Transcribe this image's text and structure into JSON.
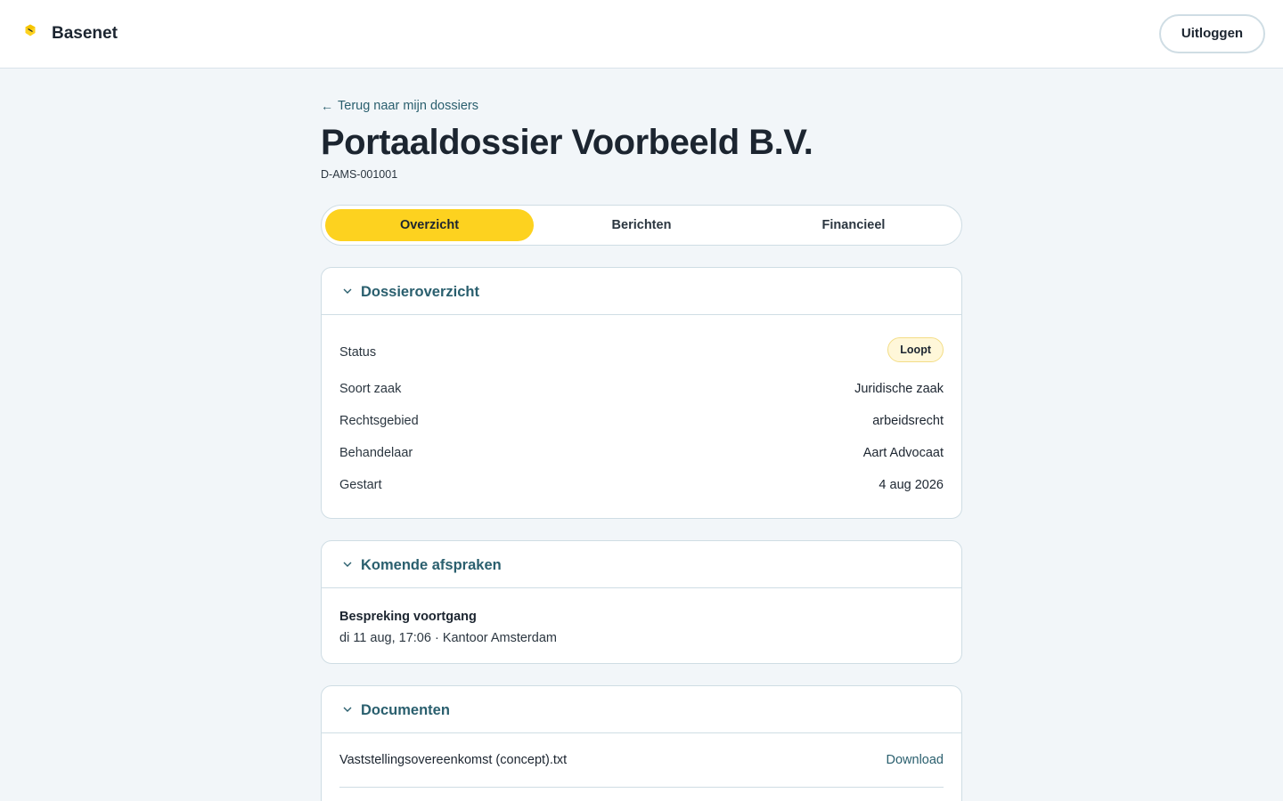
{
  "app": {
    "brand": "Basenet",
    "logout_label": "Uitloggen"
  },
  "page": {
    "back_link": "Terug naar mijn dossiers",
    "title": "Portaaldossier Voorbeeld B.V.",
    "code": "D-AMS-001001"
  },
  "tabs": [
    {
      "label": "Overzicht",
      "active": true
    },
    {
      "label": "Berichten",
      "active": false
    },
    {
      "label": "Financieel",
      "active": false
    }
  ],
  "overview": {
    "title": "Dossieroverzicht",
    "status_label": "Status",
    "status_value": "Loopt",
    "rows": [
      {
        "label": "Soort zaak",
        "value": "Juridische zaak"
      },
      {
        "label": "Rechtsgebied",
        "value": "arbeidsrecht"
      },
      {
        "label": "Behandelaar",
        "value": "Aart Advocaat"
      },
      {
        "label": "Gestart",
        "value": "4 aug 2026"
      }
    ]
  },
  "appointments": {
    "title": "Komende afspraken",
    "items": [
      {
        "title": "Bespreking voortgang",
        "detail": "di 11 aug, 17:06 · Kantoor Amsterdam"
      }
    ]
  },
  "documents": {
    "title": "Documenten",
    "items": [
      {
        "name": "Vaststellingsovereenkomst (concept).txt",
        "action": "Download"
      }
    ]
  },
  "colors": {
    "accent": "#fdd21f",
    "link": "#2a5f6e",
    "border": "#cfdde4",
    "background": "#f2f6f9",
    "badge_bg": "#fff7d9"
  }
}
